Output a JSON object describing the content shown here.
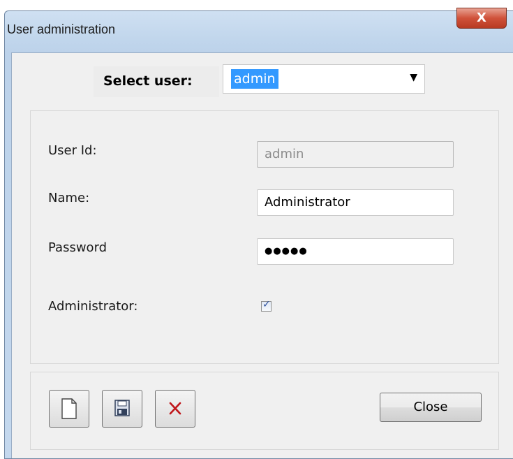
{
  "window": {
    "title": "User administration",
    "close_glyph": "X"
  },
  "select_user": {
    "label": "Select user:",
    "value": "admin"
  },
  "form": {
    "user_id_label": "User Id:",
    "user_id_value": "admin",
    "name_label": "Name:",
    "name_value": "Administrator",
    "password_label": "Password",
    "password_value": "●●●●●",
    "administrator_label": "Administrator:",
    "administrator_checked": true
  },
  "toolbar": {
    "new_icon": "new-document-icon",
    "save_icon": "floppy-disk-icon",
    "delete_icon": "delete-x-icon",
    "close_label": "Close"
  },
  "colors": {
    "selection": "#3399ff",
    "delete_red": "#c0161a",
    "title_close": "#d0523a"
  }
}
